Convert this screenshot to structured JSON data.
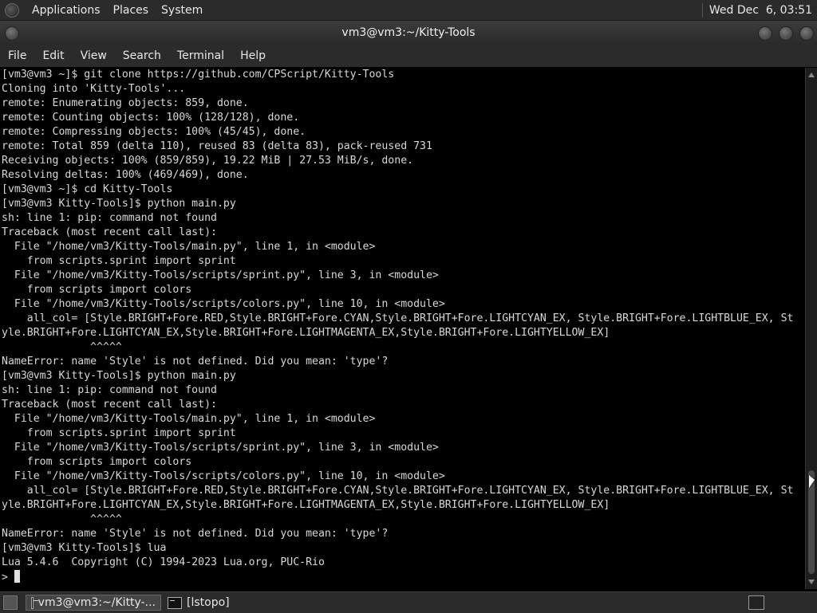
{
  "top_panel": {
    "menus": [
      "Applications",
      "Places",
      "System"
    ],
    "clock": "Wed Dec  6, 03:51"
  },
  "window": {
    "title": "vm3@vm3:~/Kitty-Tools"
  },
  "menubar": [
    "File",
    "Edit",
    "View",
    "Search",
    "Terminal",
    "Help"
  ],
  "terminal": {
    "lines": [
      "[vm3@vm3 ~]$ git clone https://github.com/CPScript/Kitty-Tools",
      "Cloning into 'Kitty-Tools'...",
      "remote: Enumerating objects: 859, done.",
      "remote: Counting objects: 100% (128/128), done.",
      "remote: Compressing objects: 100% (45/45), done.",
      "remote: Total 859 (delta 110), reused 83 (delta 83), pack-reused 731",
      "Receiving objects: 100% (859/859), 19.22 MiB | 27.53 MiB/s, done.",
      "Resolving deltas: 100% (469/469), done.",
      "[vm3@vm3 ~]$ cd Kitty-Tools",
      "[vm3@vm3 Kitty-Tools]$ python main.py",
      "sh: line 1: pip: command not found",
      "Traceback (most recent call last):",
      "  File \"/home/vm3/Kitty-Tools/main.py\", line 1, in <module>",
      "    from scripts.sprint import sprint",
      "  File \"/home/vm3/Kitty-Tools/scripts/sprint.py\", line 3, in <module>",
      "    from scripts import colors",
      "  File \"/home/vm3/Kitty-Tools/scripts/colors.py\", line 10, in <module>",
      "    all_col= [Style.BRIGHT+Fore.RED,Style.BRIGHT+Fore.CYAN,Style.BRIGHT+Fore.LIGHTCYAN_EX, Style.BRIGHT+Fore.LIGHTBLUE_EX, St",
      "yle.BRIGHT+Fore.LIGHTCYAN_EX,Style.BRIGHT+Fore.LIGHTMAGENTA_EX,Style.BRIGHT+Fore.LIGHTYELLOW_EX]",
      "              ^^^^^",
      "NameError: name 'Style' is not defined. Did you mean: 'type'?",
      "[vm3@vm3 Kitty-Tools]$ python main.py",
      "sh: line 1: pip: command not found",
      "Traceback (most recent call last):",
      "  File \"/home/vm3/Kitty-Tools/main.py\", line 1, in <module>",
      "    from scripts.sprint import sprint",
      "  File \"/home/vm3/Kitty-Tools/scripts/sprint.py\", line 3, in <module>",
      "    from scripts import colors",
      "  File \"/home/vm3/Kitty-Tools/scripts/colors.py\", line 10, in <module>",
      "    all_col= [Style.BRIGHT+Fore.RED,Style.BRIGHT+Fore.CYAN,Style.BRIGHT+Fore.LIGHTCYAN_EX, Style.BRIGHT+Fore.LIGHTBLUE_EX, St",
      "yle.BRIGHT+Fore.LIGHTCYAN_EX,Style.BRIGHT+Fore.LIGHTMAGENTA_EX,Style.BRIGHT+Fore.LIGHTYELLOW_EX]",
      "              ^^^^^",
      "NameError: name 'Style' is not defined. Did you mean: 'type'?",
      "[vm3@vm3 Kitty-Tools]$ lua",
      "Lua 5.4.6  Copyright (C) 1994-2023 Lua.org, PUC-Rio"
    ],
    "prompt": "> "
  },
  "taskbar": {
    "tasks": [
      {
        "label": "vm3@vm3:~/Kitty-...",
        "icon": "terminal-icon"
      },
      {
        "label": "[lstopo]",
        "icon": "window-icon"
      }
    ]
  },
  "colors": {
    "panel_bg": "#2b2b2b",
    "terminal_bg": "#000000",
    "terminal_fg": "#d8d8d8"
  }
}
